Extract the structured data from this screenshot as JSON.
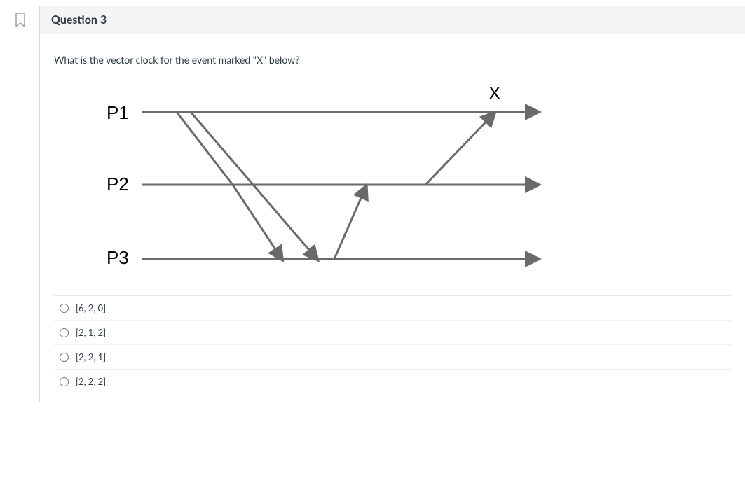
{
  "header": {
    "title": "Question 3"
  },
  "prompt": "What is the vector clock for the event marked \"X\" below?",
  "diagram": {
    "processes": [
      "P1",
      "P2",
      "P3"
    ],
    "event_label": "X"
  },
  "answers": [
    {
      "label": "[6, 2, 0]"
    },
    {
      "label": "[2, 1, 2]"
    },
    {
      "label": "[2, 2, 1]"
    },
    {
      "label": "[2, 2, 2]"
    }
  ]
}
